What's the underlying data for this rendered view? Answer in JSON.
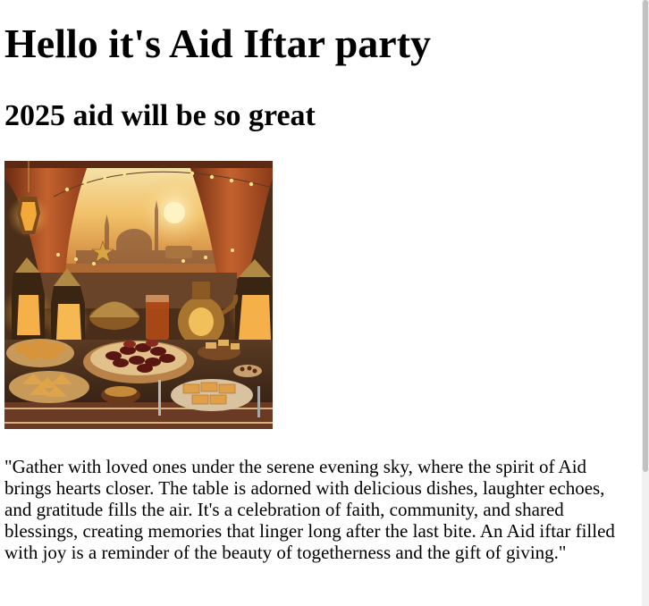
{
  "page": {
    "title": "Hello it's Aid Iftar party",
    "subtitle": "2025 aid will be so great",
    "description": "\"Gather with loved ones under the serene evening sky, where the spirit of Aid brings hearts closer. The table is adorned with delicious dishes, laughter echoes, and gratitude fills the air. It's a celebration of faith, community, and shared blessings, creating memories that linger long after the last bite. An Aid iftar filled with joy is a reminder of the beauty of togetherness and the gift of giving.\""
  },
  "image": {
    "subject": "iftar-table-illustration",
    "colors": {
      "sky": "#f2c26a",
      "curtain": "#b45a2b",
      "wall": "#6e4426",
      "table": "#3a2418",
      "gold": "#d9a441",
      "dates": "#5a1712",
      "pastry": "#d7943a"
    }
  }
}
